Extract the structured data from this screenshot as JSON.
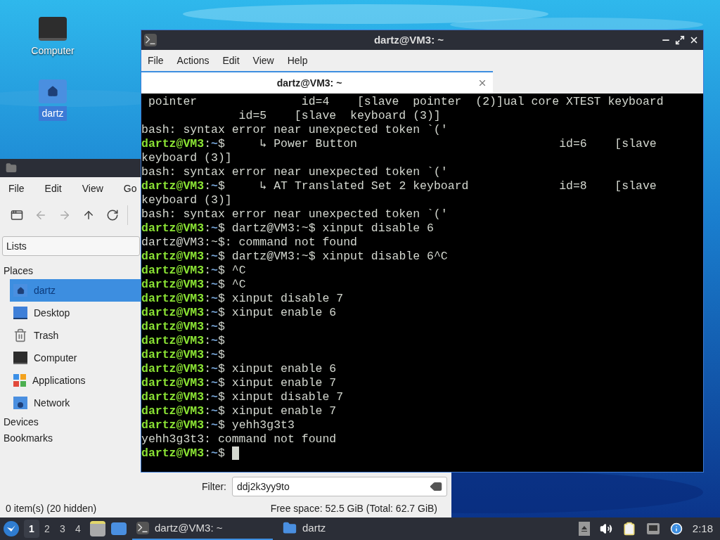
{
  "desktop": {
    "icons": [
      {
        "label": "Computer",
        "kind": "computer",
        "selected": false
      },
      {
        "label": "dartz",
        "kind": "home-folder",
        "selected": true
      }
    ]
  },
  "file_manager": {
    "menu": [
      "File",
      "Edit",
      "View",
      "Go"
    ],
    "toolbar": [
      {
        "kind": "new-window",
        "disabled": false
      },
      {
        "kind": "back",
        "disabled": true
      },
      {
        "kind": "forward",
        "disabled": true
      },
      {
        "kind": "up",
        "disabled": false
      },
      {
        "kind": "reload",
        "disabled": false
      }
    ],
    "side_pane_mode": "Lists",
    "sections": [
      {
        "title": "Places",
        "items": [
          {
            "label": "dartz",
            "kind": "home",
            "selected": true
          },
          {
            "label": "Desktop",
            "kind": "desktop",
            "selected": false
          },
          {
            "label": "Trash",
            "kind": "trash",
            "selected": false
          },
          {
            "label": "Computer",
            "kind": "computer",
            "selected": false
          },
          {
            "label": "Applications",
            "kind": "applications",
            "selected": false
          },
          {
            "label": "Network",
            "kind": "network",
            "selected": false
          }
        ]
      },
      {
        "title": "Devices"
      },
      {
        "title": "Bookmarks"
      }
    ],
    "filter": {
      "label": "Filter:",
      "value": "ddj2k3yy9to"
    },
    "status_left": "0 item(s) (20 hidden)",
    "status_right": "Free space: 52.5 GiB (Total: 62.7 GiB)"
  },
  "terminal": {
    "title": "dartz@VM3: ~",
    "menu": [
      "File",
      "Actions",
      "Edit",
      "View",
      "Help"
    ],
    "tabs": [
      {
        "label": "dartz@VM3: ~",
        "selected": true
      }
    ],
    "lines": [
      {
        "kind": "output",
        "text": " pointer               id=4    [slave  pointer  (2)]ual core XTEST keyboard"
      },
      {
        "kind": "output",
        "text": "              id=5    [slave  keyboard (3)]"
      },
      {
        "kind": "output",
        "text": "bash: syntax error near unexpected token `('"
      },
      {
        "kind": "prompt",
        "host": "dartz@VM3",
        "colon": ":",
        "path": "~",
        "sign": "$",
        "command": "     ↳ Power Button                             id=6    [slave"
      },
      {
        "kind": "output",
        "text": "keyboard (3)]"
      },
      {
        "kind": "output",
        "text": "bash: syntax error near unexpected token `('"
      },
      {
        "kind": "prompt",
        "host": "dartz@VM3",
        "colon": ":",
        "path": "~",
        "sign": "$",
        "command": "     ↳ AT Translated Set 2 keyboard             id=8    [slave"
      },
      {
        "kind": "output",
        "text": "keyboard (3)]"
      },
      {
        "kind": "output",
        "text": "bash: syntax error near unexpected token `('"
      },
      {
        "kind": "prompt",
        "host": "dartz@VM3",
        "colon": ":",
        "path": "~",
        "sign": "$",
        "command": " dartz@VM3:~$ xinput disable 6"
      },
      {
        "kind": "output",
        "text": "dartz@VM3:~$: command not found"
      },
      {
        "kind": "prompt",
        "host": "dartz@VM3",
        "colon": ":",
        "path": "~",
        "sign": "$",
        "command": " dartz@VM3:~$ xinput disable 6^C"
      },
      {
        "kind": "prompt",
        "host": "dartz@VM3",
        "colon": ":",
        "path": "~",
        "sign": "$",
        "command": " ^C"
      },
      {
        "kind": "prompt",
        "host": "dartz@VM3",
        "colon": ":",
        "path": "~",
        "sign": "$",
        "command": " ^C"
      },
      {
        "kind": "prompt",
        "host": "dartz@VM3",
        "colon": ":",
        "path": "~",
        "sign": "$",
        "command": " xinput disable 7"
      },
      {
        "kind": "prompt",
        "host": "dartz@VM3",
        "colon": ":",
        "path": "~",
        "sign": "$",
        "command": " xinput enable 6"
      },
      {
        "kind": "prompt",
        "host": "dartz@VM3",
        "colon": ":",
        "path": "~",
        "sign": "$"
      },
      {
        "kind": "prompt",
        "host": "dartz@VM3",
        "colon": ":",
        "path": "~",
        "sign": "$"
      },
      {
        "kind": "prompt",
        "host": "dartz@VM3",
        "colon": ":",
        "path": "~",
        "sign": "$"
      },
      {
        "kind": "prompt",
        "host": "dartz@VM3",
        "colon": ":",
        "path": "~",
        "sign": "$",
        "command": " xinput enable 6"
      },
      {
        "kind": "prompt",
        "host": "dartz@VM3",
        "colon": ":",
        "path": "~",
        "sign": "$",
        "command": " xinput enable 7"
      },
      {
        "kind": "prompt",
        "host": "dartz@VM3",
        "colon": ":",
        "path": "~",
        "sign": "$",
        "command": " xinput disable 7"
      },
      {
        "kind": "prompt",
        "host": "dartz@VM3",
        "colon": ":",
        "path": "~",
        "sign": "$",
        "command": " xinput enable 7"
      },
      {
        "kind": "prompt",
        "host": "dartz@VM3",
        "colon": ":",
        "path": "~",
        "sign": "$",
        "command": " yehh3g3t3"
      },
      {
        "kind": "output",
        "text": "yehh3g3t3: command not found"
      },
      {
        "kind": "prompt",
        "host": "dartz@VM3",
        "colon": ":",
        "path": "~",
        "sign": "$",
        "cursor": true
      }
    ]
  },
  "taskbar": {
    "workspaces": [
      {
        "label": "1",
        "selected": true
      },
      {
        "label": "2",
        "selected": false
      },
      {
        "label": "3",
        "selected": false
      },
      {
        "label": "4",
        "selected": false
      }
    ],
    "tasks": [
      {
        "label": "dartz@VM3: ~",
        "kind": "terminal",
        "selected": true
      },
      {
        "label": "dartz",
        "kind": "folder",
        "selected": false
      }
    ],
    "clock": "2:18"
  }
}
